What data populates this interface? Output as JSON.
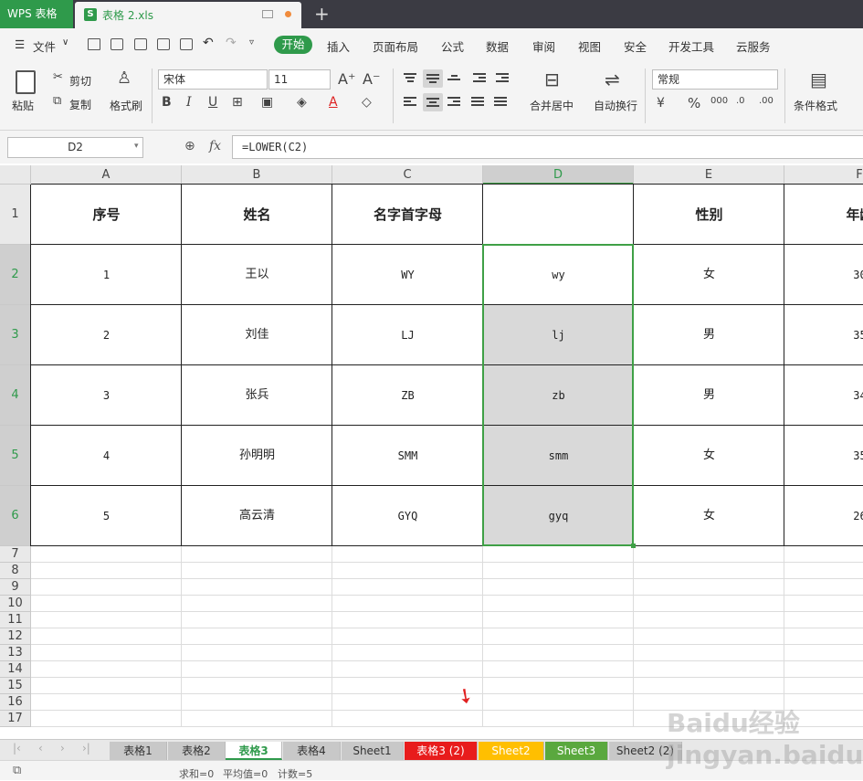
{
  "titlebar": {
    "app_name": "WPS 表格",
    "doc_name": "表格 2.xls",
    "new_tab": "+"
  },
  "menu": {
    "file": "文件",
    "tabs": [
      "开始",
      "插入",
      "页面布局",
      "公式",
      "数据",
      "审阅",
      "视图",
      "安全",
      "开发工具",
      "云服务"
    ]
  },
  "ribbon": {
    "paste": "粘贴",
    "cut": "剪切",
    "copy": "复制",
    "format_painter": "格式刷",
    "font_name": "宋体",
    "font_size": "11",
    "merge_center": "合并居中",
    "wrap_text": "自动换行",
    "number_format": "常规",
    "cond_format": "条件格式"
  },
  "formula_bar": {
    "name_box": "D2",
    "fx": "fx",
    "formula": "=LOWER(C2)"
  },
  "columns": [
    "A",
    "B",
    "C",
    "D",
    "E",
    "F"
  ],
  "rows": [
    "1",
    "2",
    "3",
    "4",
    "5",
    "6",
    "7",
    "8",
    "9",
    "10",
    "11",
    "12",
    "13",
    "14",
    "15",
    "16",
    "17"
  ],
  "table": {
    "headers": [
      "序号",
      "姓名",
      "名字首字母",
      "",
      "性别",
      "年龄"
    ],
    "rows": [
      [
        "1",
        "王以",
        "WY",
        "wy",
        "女",
        "30"
      ],
      [
        "2",
        "刘佳",
        "LJ",
        "lj",
        "男",
        "35"
      ],
      [
        "3",
        "张兵",
        "ZB",
        "zb",
        "男",
        "34"
      ],
      [
        "4",
        "孙明明",
        "SMM",
        "smm",
        "女",
        "35"
      ],
      [
        "5",
        "高云清",
        "GYQ",
        "gyq",
        "女",
        "26"
      ]
    ]
  },
  "sheet_tabs": [
    "表格1",
    "表格2",
    "表格3",
    "表格4",
    "Sheet1",
    "表格3 (2)",
    "Sheet2",
    "Sheet3",
    "Sheet2 (2)"
  ],
  "active_sheet": "表格3",
  "status": {
    "sum": "求和=0",
    "average": "平均值=0",
    "count": "计数=5"
  },
  "watermark": "Baidu经验 jingyan.baidu.com",
  "colors": {
    "accent": "#2f9a4b",
    "selection_border": "#3fa046",
    "tab_red": "#e81c1c",
    "tab_orange": "#ffbf00",
    "tab_green": "#5aa83e"
  }
}
